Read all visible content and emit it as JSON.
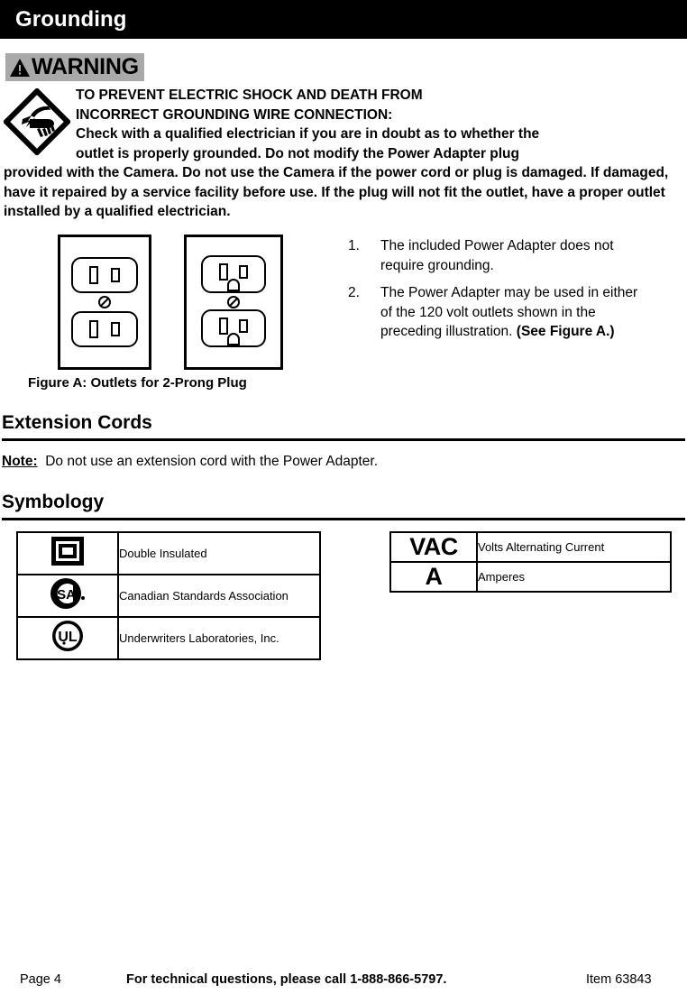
{
  "header": {
    "title": "Grounding"
  },
  "warning": {
    "banner_label": "WARNING",
    "banner_icon": "warning-triangle-icon",
    "hazard_icon": "electric-shock-hazard-icon",
    "line1": "TO PREVENT ELECTRIC SHOCK AND DEATH FROM",
    "line2": "INCORRECT GROUNDING WIRE CONNECTION:",
    "line3": "Check with a qualified electrician if you are in doubt as to whether the",
    "line4": "outlet is properly grounded.  Do not modify the Power Adapter plug",
    "body": "provided with the Camera.  Do not use the Camera if the power cord or plug is damaged.  If damaged, have it repaired by a service facility before use.  If the plug will not fit the outlet, have a proper outlet installed by a qualified electrician."
  },
  "figure": {
    "caption": "Figure A:  Outlets for 2-Prong Plug",
    "left_outlet_name": "two-prong-outlet-icon",
    "right_outlet_name": "three-prong-grounded-outlet-icon"
  },
  "instructions": [
    {
      "number": "1.",
      "text": "The included Power Adapter does not require grounding.",
      "bold_suffix": ""
    },
    {
      "number": "2.",
      "text": "The Power Adapter may be used in either of the 120 volt outlets shown in the preceding illustration.  ",
      "bold_suffix": "(See Figure A.)"
    }
  ],
  "extension_cords": {
    "heading": "Extension Cords",
    "note_label": "Note:",
    "note_text": "Do not use an extension cord with the Power Adapter."
  },
  "symbology": {
    "heading": "Symbology",
    "left_rows": [
      {
        "icon": "double-insulated-icon",
        "label": "Double Insulated"
      },
      {
        "icon": "csa-logo-icon",
        "label": "Canadian Standards Association"
      },
      {
        "icon": "ul-logo-icon",
        "label": "Underwriters Laboratories, Inc."
      }
    ],
    "right_rows": [
      {
        "abbr": "VAC",
        "label": "Volts Alternating Current"
      },
      {
        "abbr": "A",
        "label": "Amperes"
      }
    ]
  },
  "footer": {
    "page": "Page 4",
    "tech": "For technical questions, please call 1-888-866-5797.",
    "item": "Item 63843"
  },
  "colors": {
    "header_bg": "#000000",
    "header_text": "#ffffff",
    "warning_banner_bg": "#a9a9a9",
    "body_text": "#000000",
    "page_bg": "#ffffff"
  }
}
